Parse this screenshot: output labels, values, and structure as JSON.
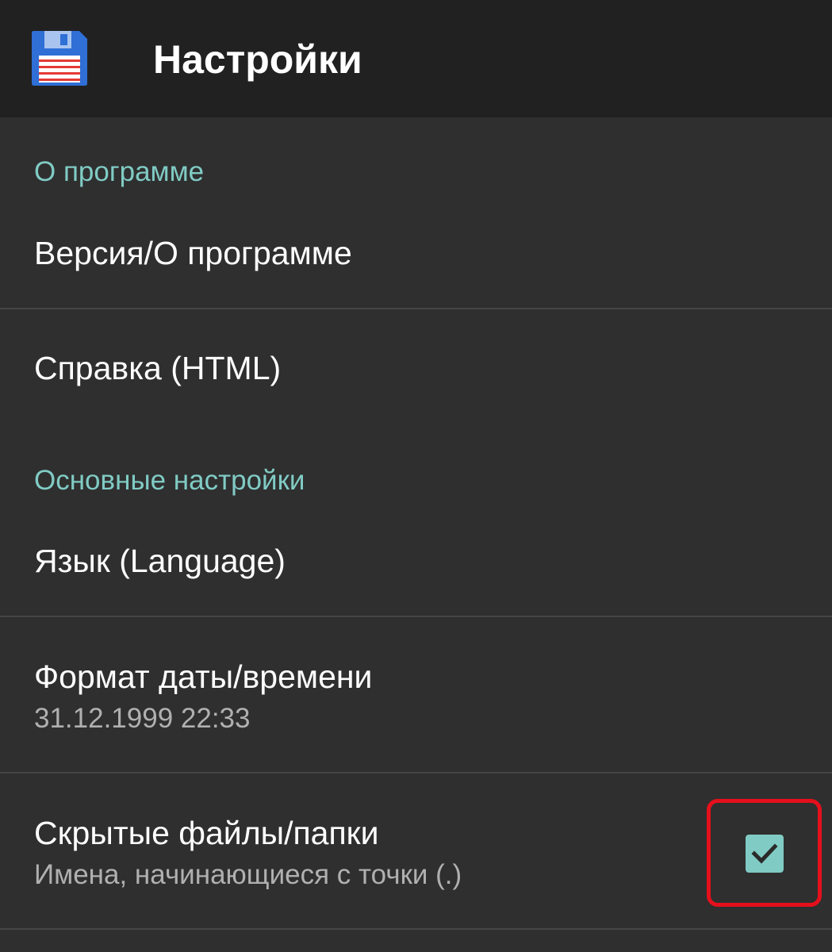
{
  "toolbar": {
    "title": "Настройки",
    "icon": "floppy-disk-icon"
  },
  "colors": {
    "accent": "#80cbc4",
    "toolbar_bg": "#212121",
    "background": "#2f2f2f",
    "highlight": "#e5101c"
  },
  "sections": {
    "about": {
      "header": "О программе",
      "version": {
        "title": "Версия/О программе"
      },
      "help": {
        "title": "Справка (HTML)"
      }
    },
    "general": {
      "header": "Основные настройки",
      "language": {
        "title": "Язык (Language)"
      },
      "datetime": {
        "title": "Формат даты/времени",
        "summary": "31.12.1999  22:33"
      },
      "hidden_files": {
        "title": "Скрытые файлы/папки",
        "summary": "Имена, начинающиеся с точки (.)",
        "checked": true
      }
    }
  }
}
